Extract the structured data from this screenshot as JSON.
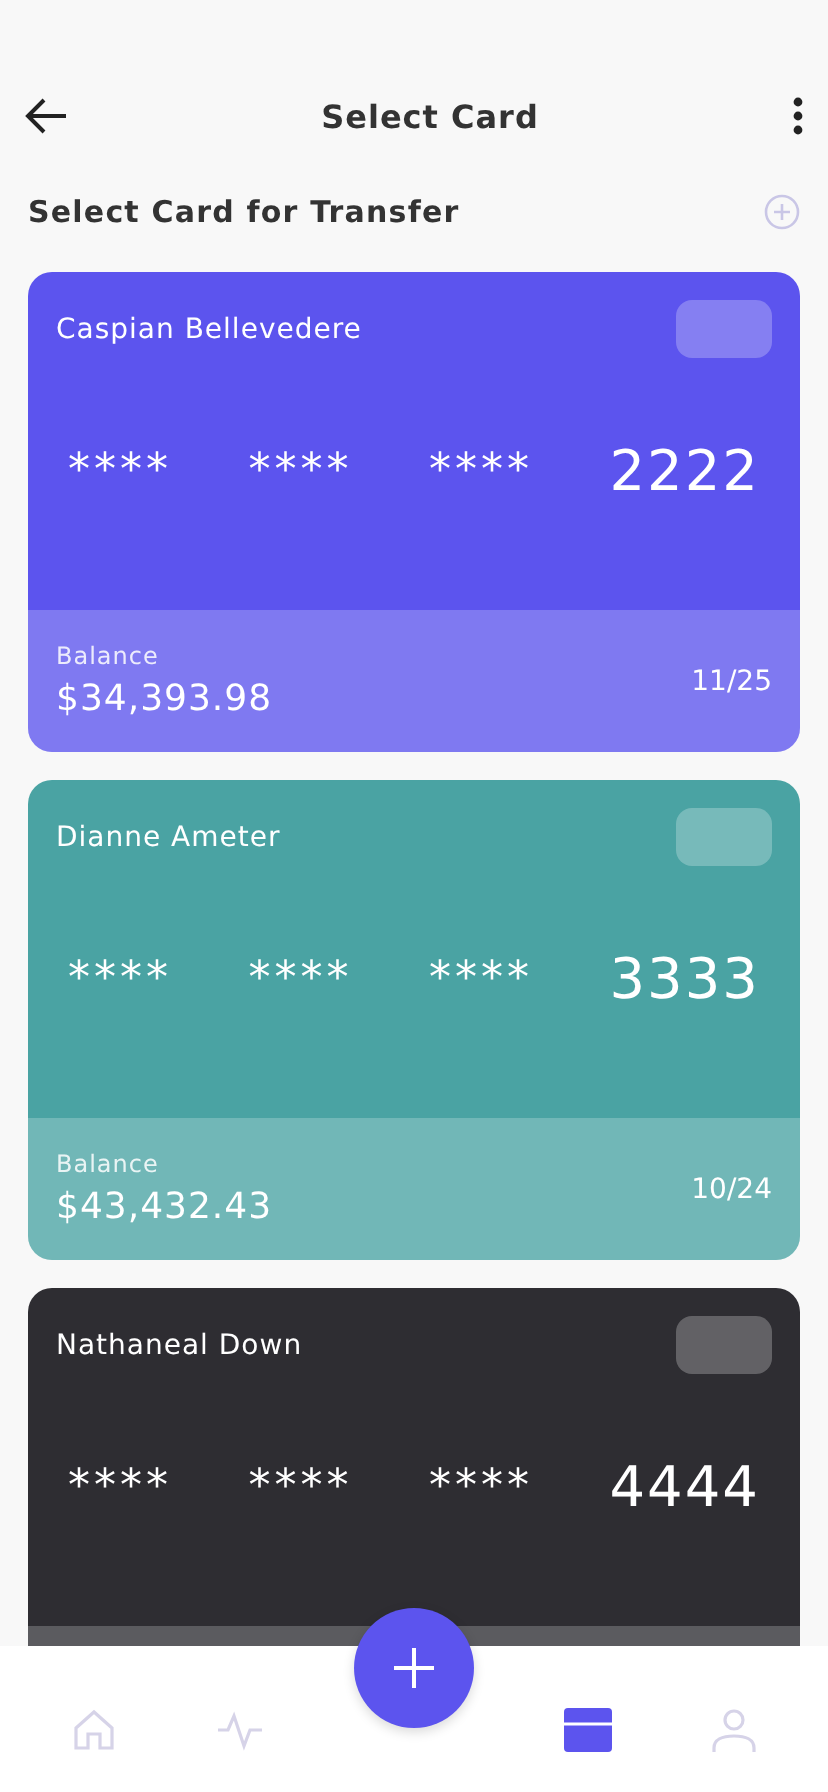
{
  "header": {
    "title": "Select Card"
  },
  "section": {
    "title": "Select Card for Transfer"
  },
  "cards": [
    {
      "holder": "Caspian Bellevedere",
      "masked": [
        "****",
        "****",
        "****"
      ],
      "last4": "2222",
      "balance_label": "Balance",
      "balance": "$34,393.98",
      "expiry": "11/25",
      "color": "#5c54ee"
    },
    {
      "holder": "Dianne Ameter",
      "masked": [
        "****",
        "****",
        "****"
      ],
      "last4": "3333",
      "balance_label": "Balance",
      "balance": "$43,432.43",
      "expiry": "10/24",
      "color": "#4aa3a3"
    },
    {
      "holder": "Nathaneal Down",
      "masked": [
        "****",
        "****",
        "****"
      ],
      "last4": "4444",
      "color": "#2e2d32"
    }
  ],
  "nav": [
    {
      "kind": "home",
      "selected": false
    },
    {
      "kind": "activity",
      "selected": false
    },
    {
      "kind": "cards",
      "selected": true
    },
    {
      "kind": "profile",
      "selected": false
    }
  ]
}
